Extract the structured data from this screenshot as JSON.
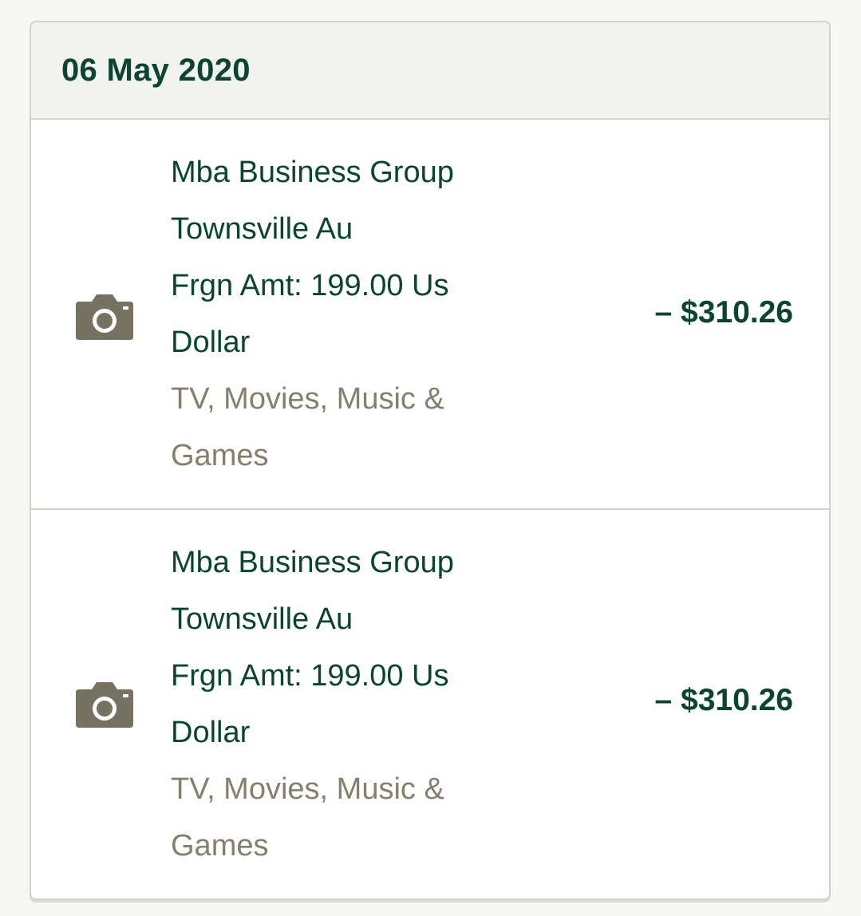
{
  "date_group": {
    "date": "06 May 2020"
  },
  "transactions": [
    {
      "icon": "camera-icon",
      "lines": [
        "Mba Business Group",
        "Townsville Au",
        "Frgn Amt: 199.00 Us",
        "Dollar"
      ],
      "category_lines": [
        "TV, Movies, Music &",
        "Games"
      ],
      "amount": "– $310.26"
    },
    {
      "icon": "camera-icon",
      "lines": [
        "Mba Business Group",
        "Townsville Au",
        "Frgn Amt: 199.00 Us",
        "Dollar"
      ],
      "category_lines": [
        "TV, Movies, Music &",
        "Games"
      ],
      "amount": "– $310.26"
    }
  ],
  "colors": {
    "primary_text": "#0b4430",
    "category_text": "#857f6b",
    "icon": "#767262",
    "header_bg": "#f2f2f0",
    "border": "#d3d3cb"
  }
}
